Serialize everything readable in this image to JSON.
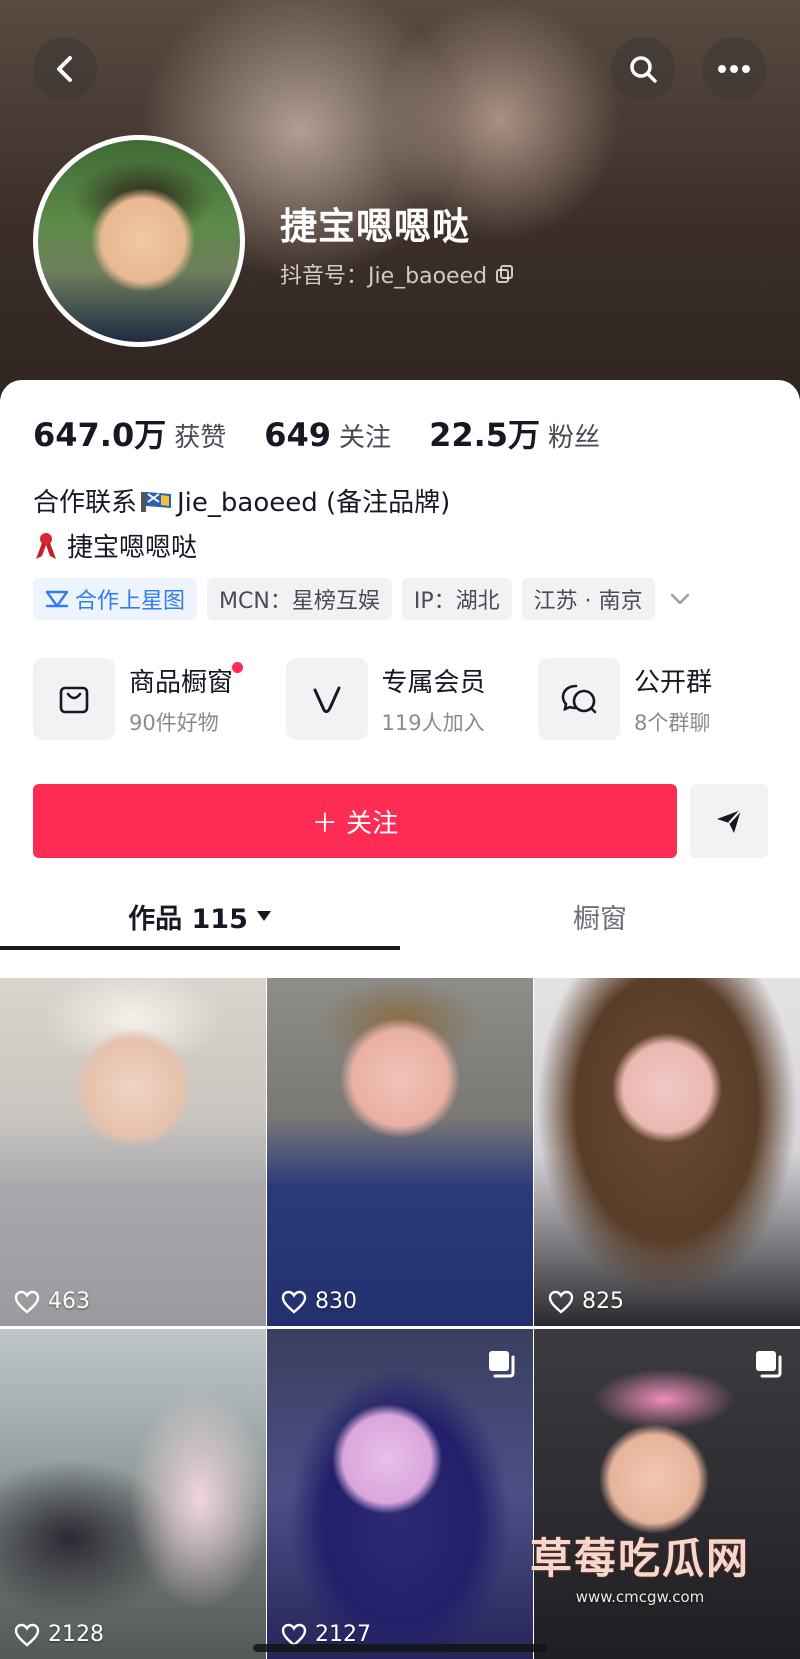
{
  "header": {
    "nickname": "捷宝嗯嗯哒",
    "douyin_id_label": "抖音号：Jie_baoeed"
  },
  "stats": [
    {
      "value": "647.0万",
      "label": "获赞"
    },
    {
      "value": "649",
      "label": "关注"
    },
    {
      "value": "22.5万",
      "label": "粉丝"
    }
  ],
  "bio": {
    "line1_prefix": "合作联系",
    "line1_suffix": "Jie_baoeed (备注品牌)",
    "line2": "捷宝嗯嗯哒"
  },
  "tags": [
    {
      "label": "合作上星图",
      "icon": "star-map-icon"
    },
    {
      "label": "MCN：星榜互娱"
    },
    {
      "label": "IP：湖北"
    },
    {
      "label": "江苏 · 南京"
    }
  ],
  "features": [
    {
      "title": "商品橱窗",
      "sub": "90件好物",
      "icon": "shopping-bag-icon",
      "badge": true
    },
    {
      "title": "专属会员",
      "sub": "119人加入",
      "icon": "vip-v-icon"
    },
    {
      "title": "公开群",
      "sub": "8个群聊",
      "icon": "group-chat-icon"
    }
  ],
  "actions": {
    "follow_label": "＋ 关注"
  },
  "tabs": [
    {
      "label": "作品 115",
      "active": true
    },
    {
      "label": "橱窗",
      "active": false
    }
  ],
  "videos": [
    {
      "likes": "463"
    },
    {
      "likes": "830"
    },
    {
      "likes": "825"
    },
    {
      "likes": "2128"
    },
    {
      "likes": "2127",
      "multi": true
    },
    {
      "likes": "",
      "multi": true
    }
  ],
  "watermark": {
    "main": "草莓吃瓜网",
    "sub": "www.cmcgw.com"
  },
  "colors": {
    "accent": "#fe2c55",
    "star_blue": "#2f7df1"
  }
}
